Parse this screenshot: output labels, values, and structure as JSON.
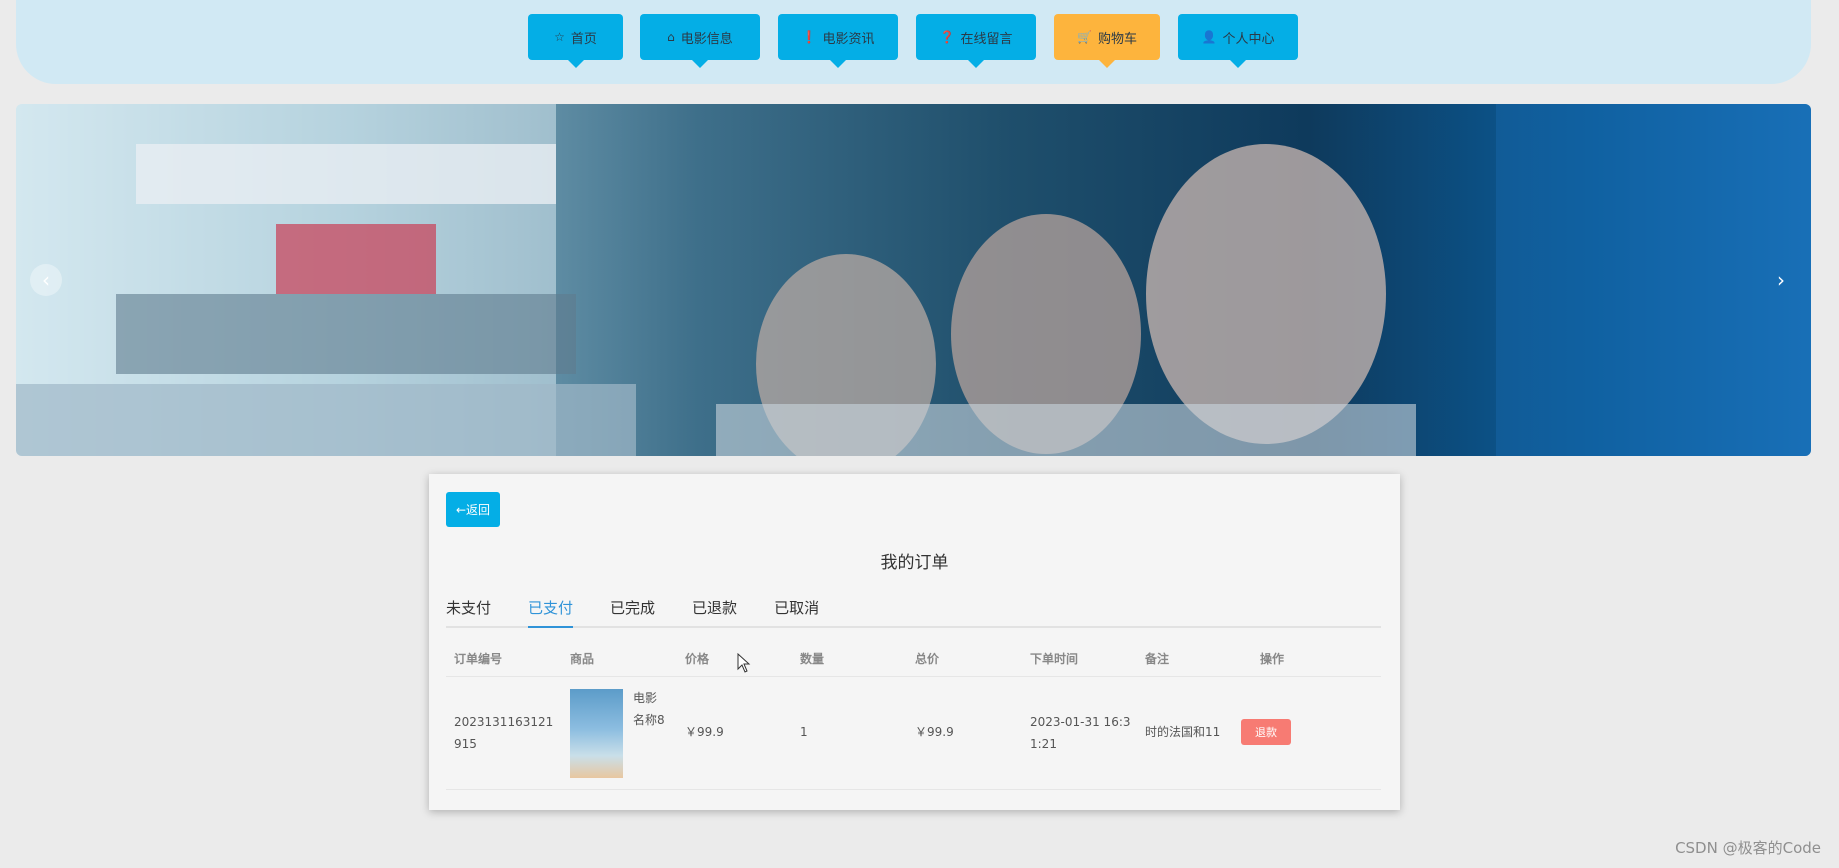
{
  "nav": [
    {
      "label": "首页",
      "icon": "star-icon",
      "glyph": "☆"
    },
    {
      "label": "电影信息",
      "icon": "bag-icon",
      "glyph": "⌂"
    },
    {
      "label": "电影资讯",
      "icon": "info-icon",
      "glyph": "❗"
    },
    {
      "label": "在线留言",
      "icon": "question-icon",
      "glyph": "❓"
    },
    {
      "label": "购物车",
      "icon": "cart-icon",
      "glyph": "🛒",
      "active": true
    },
    {
      "label": "个人中心",
      "icon": "user-icon",
      "glyph": "👤"
    }
  ],
  "banner": {
    "prev": "‹",
    "next": "›"
  },
  "order": {
    "back_label": "←返回",
    "title": "我的订单",
    "tabs": [
      "未支付",
      "已支付",
      "已完成",
      "已退款",
      "已取消"
    ],
    "active_tab": "已支付",
    "columns": [
      "订单编号",
      "商品",
      "价格",
      "数量",
      "总价",
      "下单时间",
      "备注",
      "操作"
    ],
    "rows": [
      {
        "order_no_line1": "2023131163121",
        "order_no_line2": "915",
        "product_line1": "电影",
        "product_line2": "名称8",
        "price": "￥99.9",
        "quantity": "1",
        "total": "￥99.9",
        "time_line1": "2023-01-31 16:3",
        "time_line2": "1:21",
        "remark": "时的法国和11",
        "action": "退款"
      }
    ]
  },
  "colors": {
    "nav_bg": "#04aee6",
    "nav_active": "#fdb43d",
    "refund": "#f77b73",
    "tab_active": "#2f93d8"
  },
  "watermark": "CSDN @极客的Code"
}
